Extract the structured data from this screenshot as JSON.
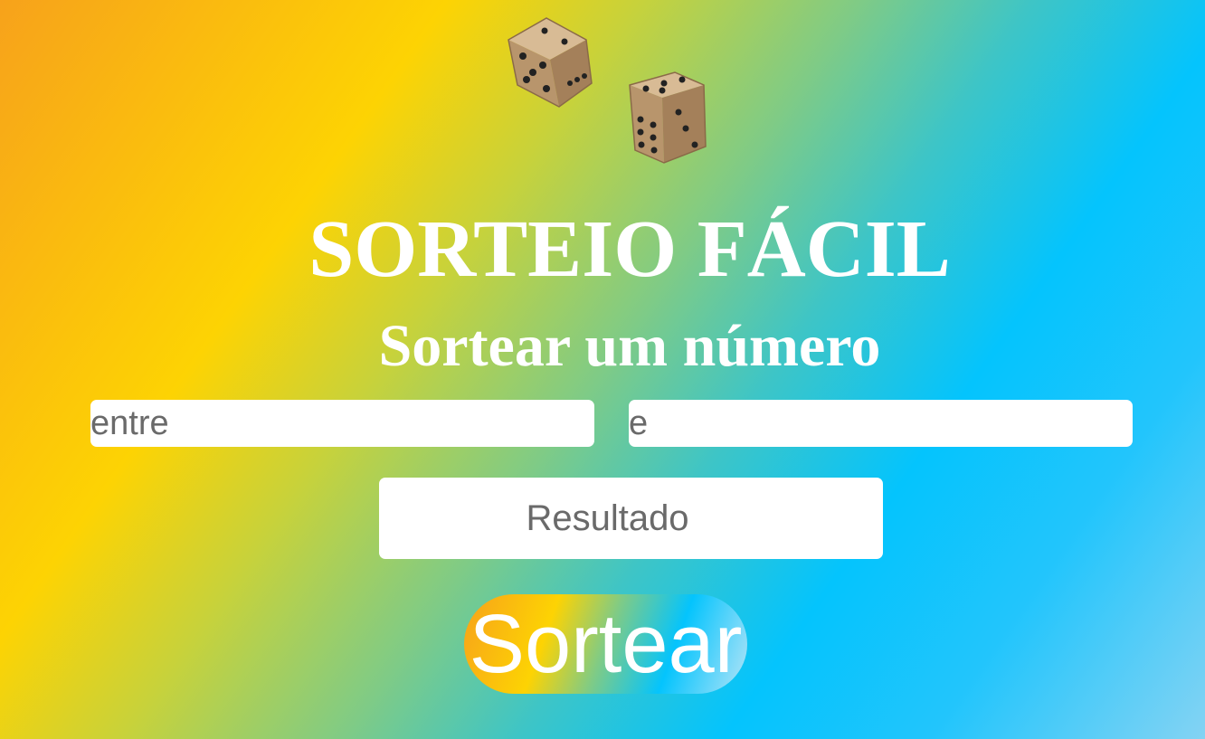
{
  "header": {
    "title": "SORTEIO FÁCIL",
    "subtitle": "Sortear um número"
  },
  "images": {
    "dice": "dice-icon"
  },
  "form": {
    "from_placeholder": "entre",
    "from_value": "",
    "to_placeholder": "e",
    "to_value": "",
    "result_label": "Resultado",
    "draw_button_label": "Sortear"
  },
  "colors": {
    "gradient_orange": "#f7a21b",
    "gradient_yellow": "#fdd303",
    "gradient_blue": "#04c4fd",
    "gradient_light_blue": "#84d3f3",
    "text_white": "#ffffff",
    "placeholder_gray": "#6a6a6a",
    "die_body": "#c2a07a",
    "die_pip": "#222222"
  }
}
